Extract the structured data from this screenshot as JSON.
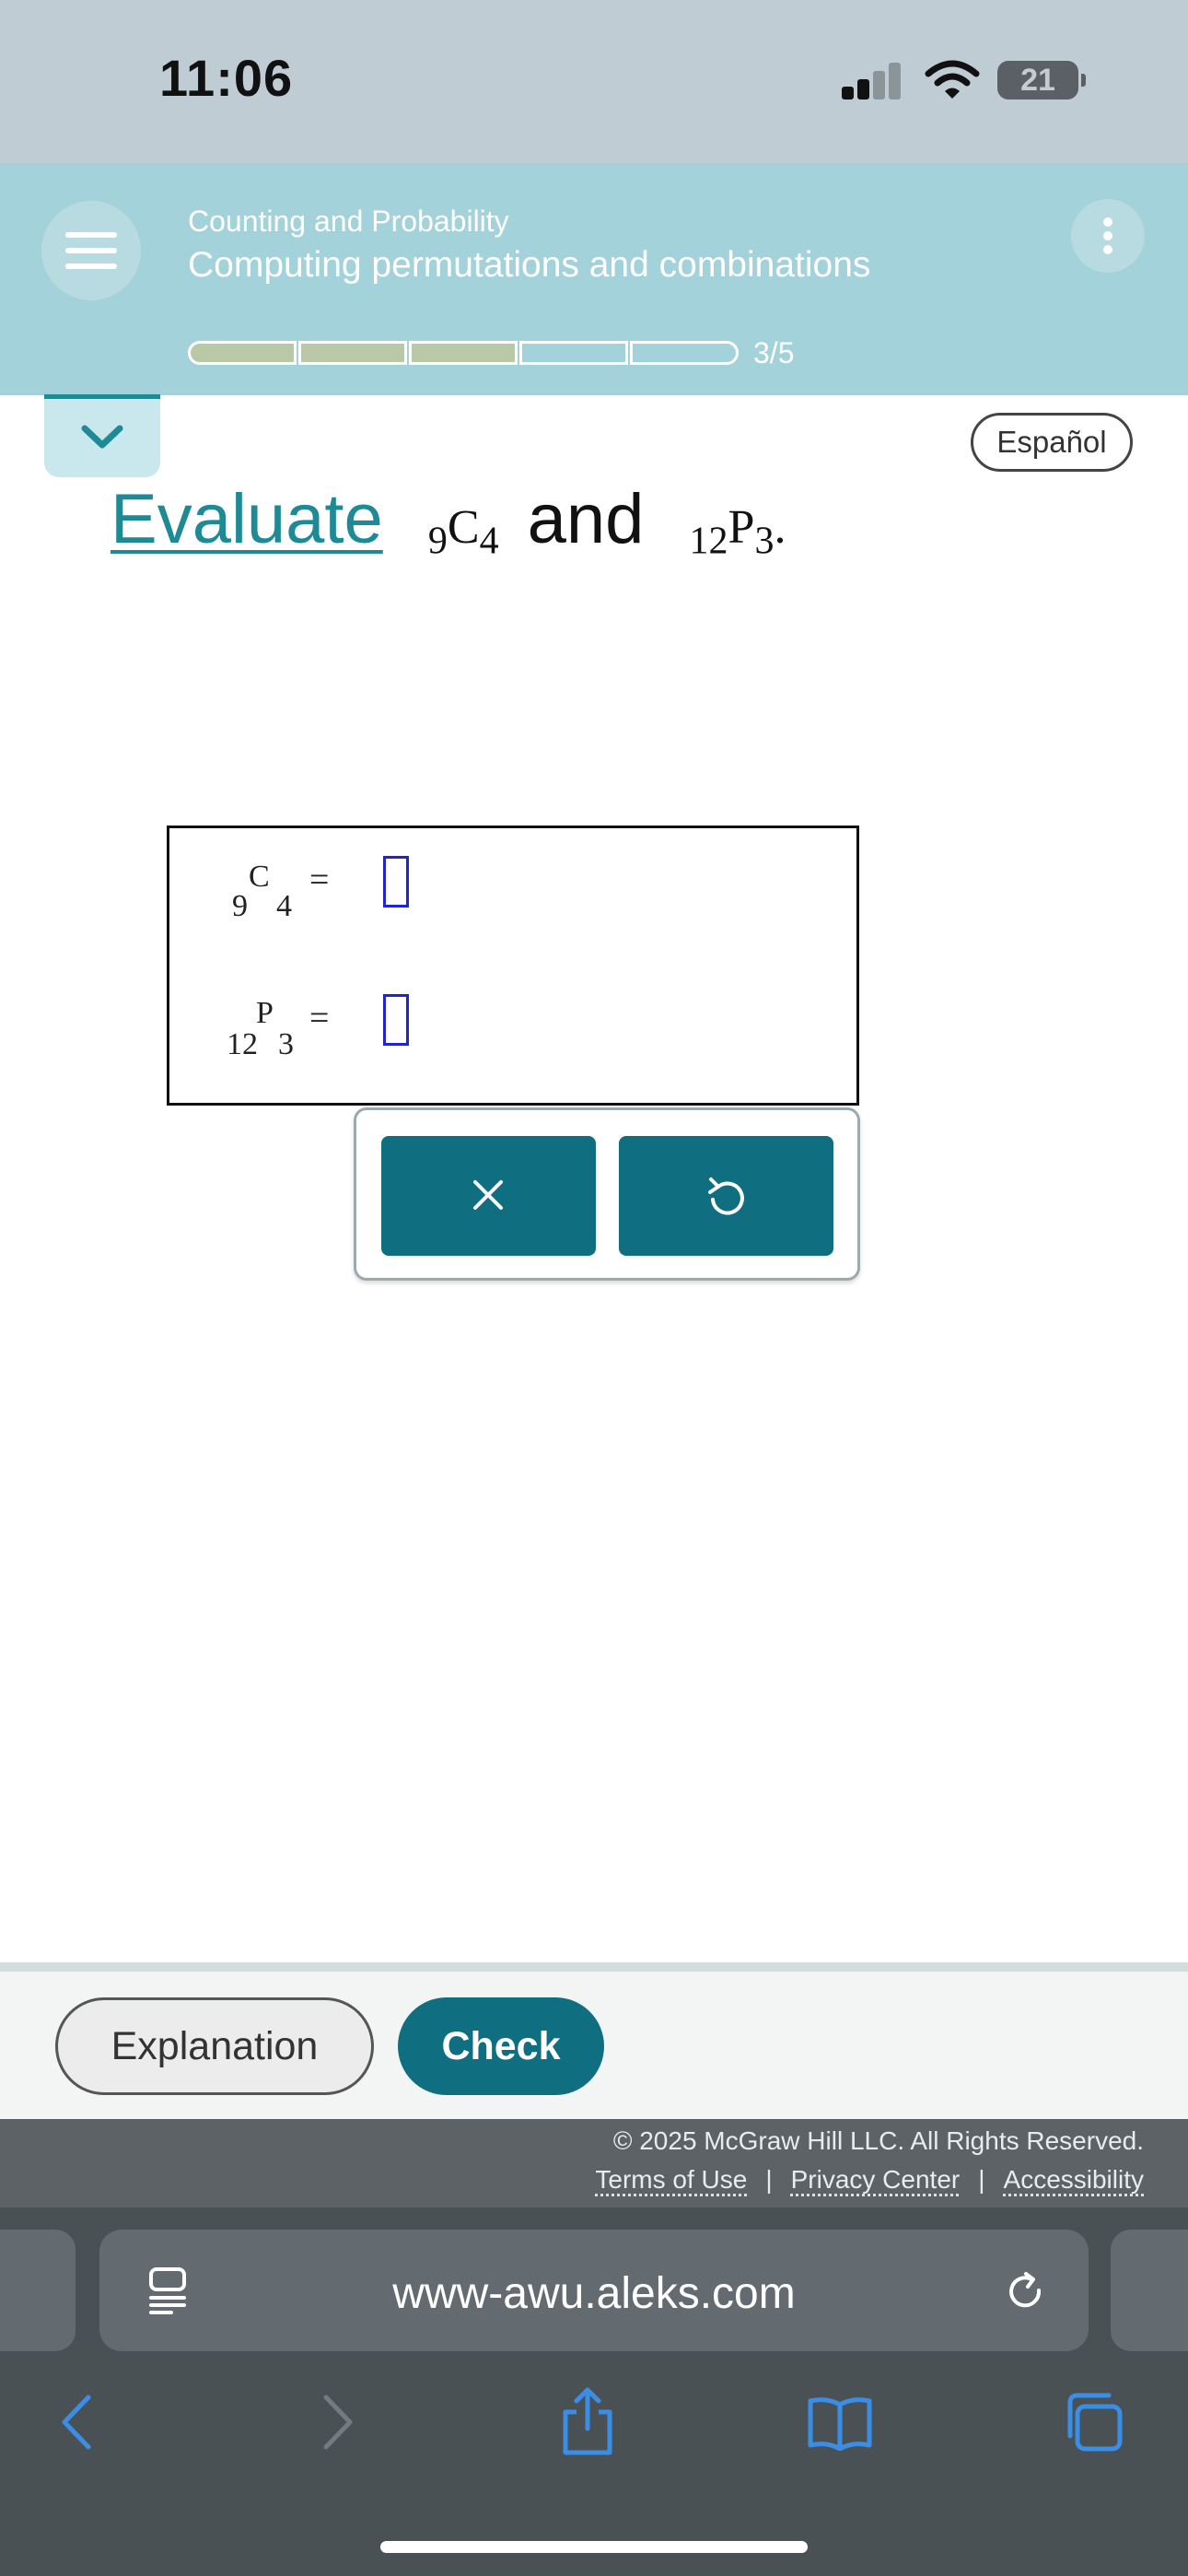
{
  "status": {
    "time": "11:06",
    "battery": "21"
  },
  "header": {
    "course": "Counting and Probability",
    "topic": "Computing permutations and combinations",
    "progress": {
      "completed": 3,
      "total": 5,
      "label": "3/5"
    }
  },
  "lang_button": "Español",
  "question": {
    "link": "Evaluate",
    "and": "and",
    "c_pre": "9",
    "c_sym": "C",
    "c_post": "4",
    "p_pre": "12",
    "p_sym": "P",
    "p_post": "3",
    "period": "."
  },
  "answers": [
    {
      "pre": "9",
      "sym": "C",
      "post": "4",
      "eq": "=",
      "value": ""
    },
    {
      "pre": "12",
      "sym": "P",
      "post": "3",
      "eq": "=",
      "value": ""
    }
  ],
  "keypad": {
    "clear_symbol": "×",
    "undo_symbol": "↺"
  },
  "actions": {
    "explanation": "Explanation",
    "check": "Check"
  },
  "footer": {
    "copyright": "© 2025 McGraw Hill LLC. All Rights Reserved.",
    "links": [
      "Terms of Use",
      "Privacy Center",
      "Accessibility"
    ],
    "separator": "|"
  },
  "browser": {
    "url": "www-awu.aleks.com"
  },
  "colors": {
    "header_bg": "#a3d2da",
    "accent": "#0f6e80",
    "link": "#1d8a96",
    "input_border": "#2323d6"
  }
}
